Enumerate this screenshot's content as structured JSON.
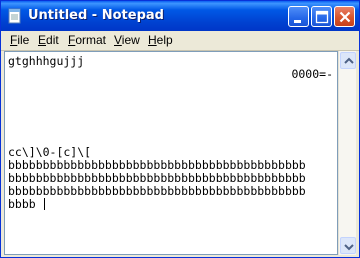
{
  "window": {
    "title": "Untitled - Notepad"
  },
  "menu": {
    "file": {
      "key": "F",
      "rest": "ile"
    },
    "edit": {
      "key": "E",
      "rest": "dit"
    },
    "format": {
      "key": "F",
      "rest": "ormat"
    },
    "view": {
      "key": "V",
      "rest": "iew"
    },
    "help": {
      "key": "H",
      "rest": "elp"
    }
  },
  "editor": {
    "lines": [
      "gtghhhgujjj",
      "0000=-",
      "cc\\]\\0-[c]\\[",
      "bbbbbbbbbbbbbbbbbbbbbbbbbbbbbbbbbbbbbbbbbbb",
      "bbbbbbbbbbbbbbbbbbbbbbbbbbbbbbbbbbbbbbbbbbb",
      "bbbbbbbbbbbbbbbbbbbbbbbbbbbbbbbbbbbbbbbbbbb",
      "bbbb "
    ]
  },
  "icons": {
    "app": "notepad-icon",
    "minimize": "minimize-icon",
    "maximize": "maximize-icon",
    "close": "close-icon",
    "scroll_up": "arrow-up-icon",
    "scroll_down": "arrow-down-icon"
  },
  "colors": {
    "titlebar": "#0058e6",
    "close_button": "#d8552c",
    "menubar": "#ece9d8"
  }
}
